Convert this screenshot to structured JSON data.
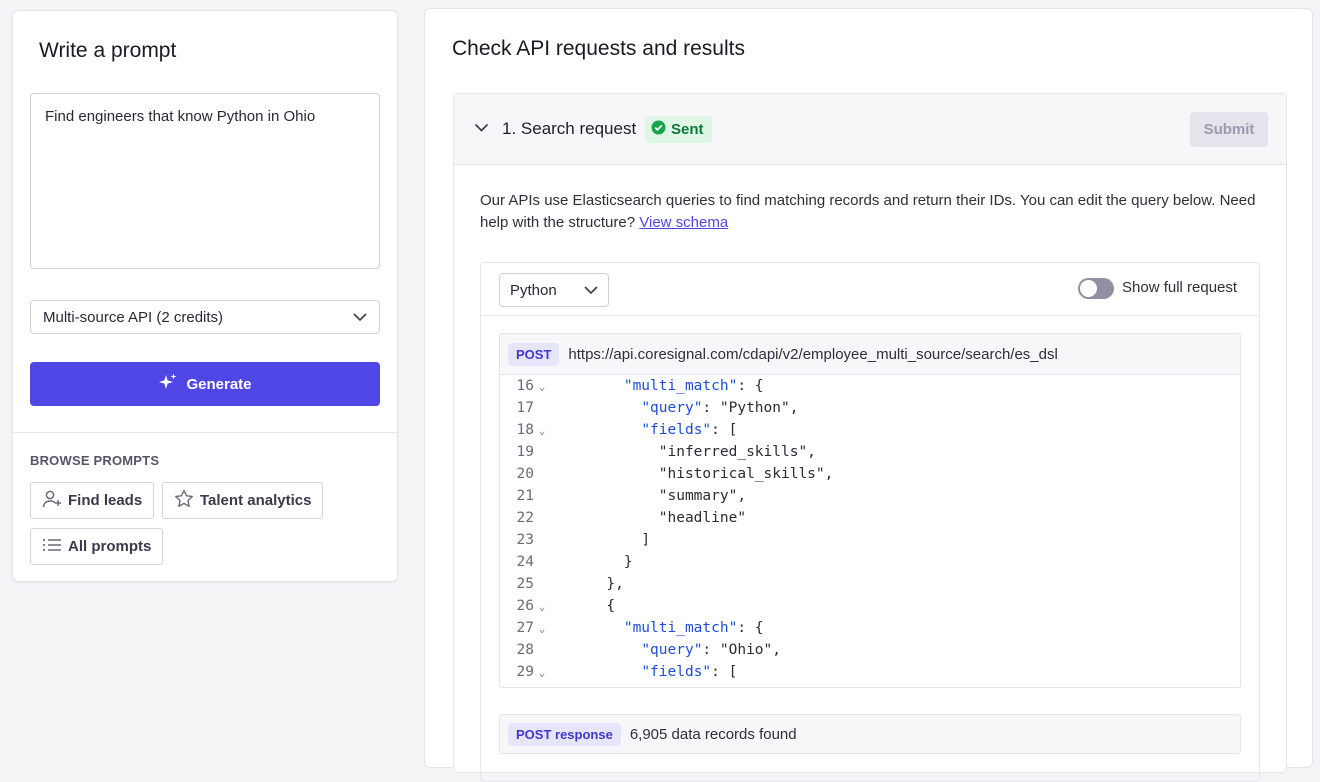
{
  "left": {
    "title": "Write a prompt",
    "prompt_value": "Find engineers that know Python in Ohio",
    "api_select": "Multi-source API (2 credits)",
    "generate_label": "Generate",
    "browse_label": "BROWSE PROMPTS",
    "chips": [
      {
        "label": "Find leads",
        "icon": "add-person-icon"
      },
      {
        "label": "Talent analytics",
        "icon": "star-icon"
      },
      {
        "label": "All prompts",
        "icon": "list-icon"
      }
    ]
  },
  "right": {
    "title": "Check API requests and results",
    "panel": {
      "title": "1. Search request",
      "status": "Sent",
      "submit_label": "Submit",
      "description": "Our APIs use Elasticsearch queries to find matching records and return their IDs. You can edit the query below. Need help with the structure?",
      "schema_link": "View schema"
    },
    "code": {
      "language": "Python",
      "toggle_label": "Show full request",
      "method": "POST",
      "url": "https://api.coresignal.com/cdapi/v2/employee_multi_source/search/es_dsl",
      "lines": [
        {
          "n": "16",
          "fold": true,
          "indent": "        ",
          "key": "\"multi_match\"",
          "rest": ": {"
        },
        {
          "n": "17",
          "fold": false,
          "indent": "          ",
          "key": "\"query\"",
          "rest": ": \"Python\","
        },
        {
          "n": "18",
          "fold": true,
          "indent": "          ",
          "key": "\"fields\"",
          "rest": ": ["
        },
        {
          "n": "19",
          "fold": false,
          "indent": "            ",
          "key": "",
          "rest": "\"inferred_skills\","
        },
        {
          "n": "20",
          "fold": false,
          "indent": "            ",
          "key": "",
          "rest": "\"historical_skills\","
        },
        {
          "n": "21",
          "fold": false,
          "indent": "            ",
          "key": "",
          "rest": "\"summary\","
        },
        {
          "n": "22",
          "fold": false,
          "indent": "            ",
          "key": "",
          "rest": "\"headline\""
        },
        {
          "n": "23",
          "fold": false,
          "indent": "          ",
          "key": "",
          "rest": "]"
        },
        {
          "n": "24",
          "fold": false,
          "indent": "        ",
          "key": "",
          "rest": "}"
        },
        {
          "n": "25",
          "fold": false,
          "indent": "      ",
          "key": "",
          "rest": "},"
        },
        {
          "n": "26",
          "fold": true,
          "indent": "      ",
          "key": "",
          "rest": "{"
        },
        {
          "n": "27",
          "fold": true,
          "indent": "        ",
          "key": "\"multi_match\"",
          "rest": ": {"
        },
        {
          "n": "28",
          "fold": false,
          "indent": "          ",
          "key": "\"query\"",
          "rest": ": \"Ohio\","
        },
        {
          "n": "29",
          "fold": true,
          "indent": "          ",
          "key": "\"fields\"",
          "rest": ": ["
        }
      ]
    },
    "response": {
      "badge": "POST response",
      "text": "6,905 data records found"
    }
  }
}
